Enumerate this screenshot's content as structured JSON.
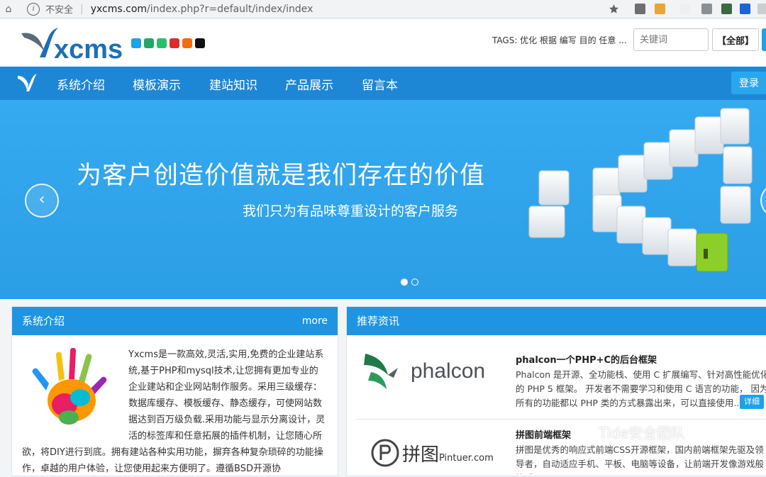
{
  "browser": {
    "home_icon": "home-icon",
    "insecure_label": "不安全",
    "url_host": "yxcms.com",
    "url_path": "/index.php?r=default/index/index"
  },
  "header": {
    "logo_text": "xcms",
    "swatch_colors": [
      "#1aa3e8",
      "#22a667",
      "#27c06a",
      "#e02a2a",
      "#f26c0d",
      "#111111"
    ],
    "tags": "TAGS: 优化 根据 编写 目的 任意 ...",
    "search_placeholder": "关键词",
    "scope_label": "【全部】"
  },
  "nav": {
    "items": [
      "系统介绍",
      "模板演示",
      "建站知识",
      "产品展示",
      "留言本"
    ],
    "login_label": "登录"
  },
  "banner": {
    "title": "为客户创造价值就是我们存在的价值",
    "subtitle": "我们只为有品味尊重设计的客户服务",
    "prev_icon": "chevron-left-icon"
  },
  "intro_panel": {
    "title": "系统介绍",
    "more": "more",
    "text": "Yxcms是一款高效,灵活,实用,免费的企业建站系统,基于PHP和mysql技术,让您拥有更加专业的企业建站和企业网站制作服务。采用三级缓存：数据库缓存、模板缓存、静态缓存，可使网站数据达到百万级负载.采用功能与显示分离设计，灵活的标签库和任意拓展的插件机制，让您随心所欲，将DIY进行到底。拥有建站各种实用功能，摒弃各种复杂琐碎的功能操作，卓越的用户体验，让您使用起来方便明了。遵循BSD开源协"
  },
  "news_panel": {
    "title": "推荐资讯",
    "items": [
      {
        "logo": "phalcon",
        "title": "phalcon一个PHP+C的后台框架",
        "desc": "Phalcon 是开源、全功能栈、使用 C 扩展编写、针对高性能优化的 PHP 5 框架。 开发者不需要学习和使用 C 语言的功能， 因为所有的功能都以 PHP 类的方式暴露出来，可以直接使用...",
        "detail": "详细"
      },
      {
        "logo": "拼图",
        "logo_sub": "Pintuer.com",
        "title": "拼图前端框架",
        "desc": "拼图是优秀的响应式前端CSS开源框架，国内前端框架先驱及领导者，自动适应手机、平板、电脑等设备，让前端开发像游戏般快乐..."
      }
    ]
  },
  "watermark": "Tide安全团队"
}
